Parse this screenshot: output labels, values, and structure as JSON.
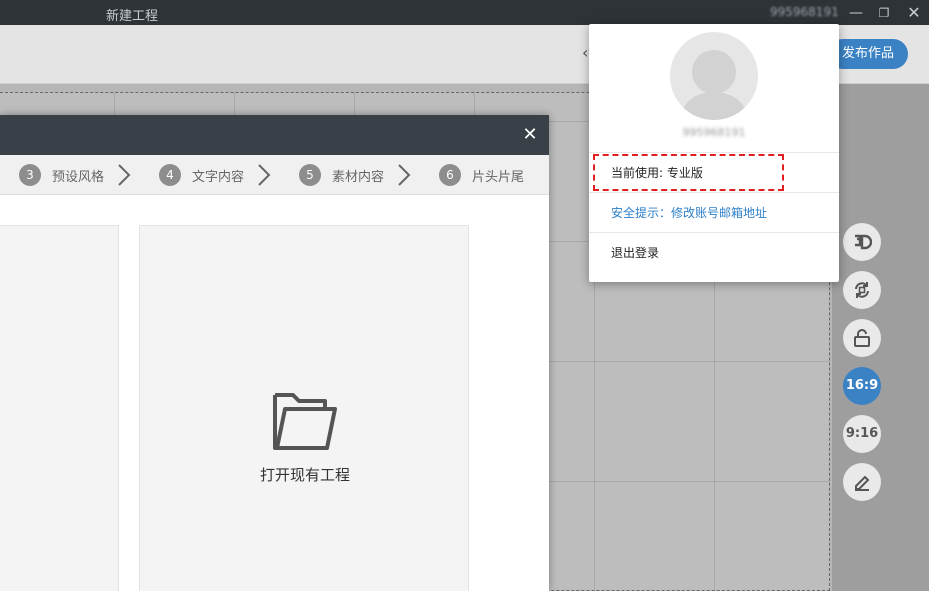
{
  "window": {
    "title": "新建工程",
    "user_id": "995968191",
    "min_glyph": "—",
    "max_glyph": "❐",
    "close_glyph": "✕"
  },
  "toolbar": {
    "publish_label": "发布作品"
  },
  "sidebar": {
    "buttons": [
      {
        "name": "3d-button",
        "label": "3D"
      },
      {
        "name": "rotate-button",
        "icon": "rotate-icon"
      },
      {
        "name": "lock-button",
        "icon": "unlock-icon"
      },
      {
        "name": "ratio-16-9-button",
        "label": "16:9",
        "active": true
      },
      {
        "name": "ratio-9-16-button",
        "label": "9:16"
      },
      {
        "name": "edit-button",
        "icon": "pen-icon"
      }
    ]
  },
  "dialog": {
    "close_glyph": "✕",
    "steps": [
      {
        "num": "3",
        "label": "预设风格"
      },
      {
        "num": "4",
        "label": "文字内容"
      },
      {
        "num": "5",
        "label": "素材内容"
      },
      {
        "num": "6",
        "label": "片头片尾"
      }
    ],
    "open_project_label": "打开现有工程"
  },
  "user_menu": {
    "user_id": "995968191",
    "plan_text": "当前使用: 专业版",
    "security_tip": "安全提示：修改账号邮箱地址",
    "logout_label": "退出登录"
  },
  "colors": {
    "accent": "#3b82c4",
    "title_bar": "#2e3338",
    "highlight_border": "#e02020"
  }
}
